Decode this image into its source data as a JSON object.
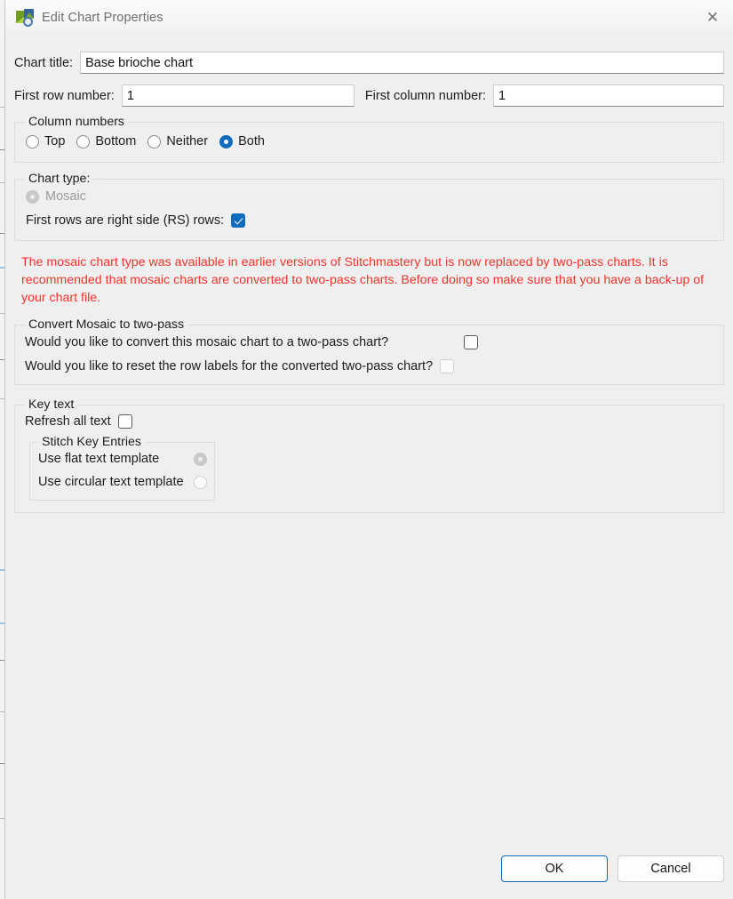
{
  "window": {
    "title": "Edit Chart Properties",
    "icon": "chart-app-icon",
    "close_label": "✕"
  },
  "fields": {
    "chart_title_label": "Chart title:",
    "chart_title_value": "Base brioche chart",
    "first_row_label": "First row number:",
    "first_row_value": "1",
    "first_column_label": "First column number:",
    "first_column_value": "1"
  },
  "column_numbers": {
    "legend": "Column numbers",
    "options": [
      {
        "label": "Top",
        "selected": false
      },
      {
        "label": "Bottom",
        "selected": false
      },
      {
        "label": "Neither",
        "selected": false
      },
      {
        "label": "Both",
        "selected": true
      }
    ]
  },
  "chart_type": {
    "legend": "Chart type:",
    "option_label": "Mosaic",
    "option_selected": true,
    "option_disabled": true,
    "rs_rows_label": "First rows are right side (RS) rows:",
    "rs_rows_checked": true
  },
  "warning": {
    "text": "The mosaic chart type was available in earlier versions of Stitchmastery but is now replaced by two-pass charts. It is recommended that mosaic charts are converted to two-pass charts. Before doing so make sure that you have a back-up of your chart file.",
    "color": "#f2342b"
  },
  "convert": {
    "legend": "Convert Mosaic to two-pass",
    "convert_label": "Would you like to convert this mosaic chart to a two-pass chart?",
    "convert_checked": false,
    "reset_labels_label": "Would you like to reset the row labels for the converted two-pass chart?",
    "reset_labels_checked": false,
    "reset_labels_disabled": true
  },
  "key_text": {
    "legend": "Key text",
    "refresh_all_label": "Refresh all text",
    "refresh_all_checked": false,
    "stitch_key": {
      "legend": "Stitch Key Entries",
      "options": [
        {
          "label": "Use flat text template",
          "selected": true,
          "disabled": true
        },
        {
          "label": "Use circular text template",
          "selected": false,
          "disabled": true
        }
      ]
    }
  },
  "footer": {
    "ok_label": "OK",
    "cancel_label": "Cancel"
  },
  "colors": {
    "accent": "#0f6cbd",
    "dialog_bg": "#efefef",
    "warning": "#f2342b"
  }
}
